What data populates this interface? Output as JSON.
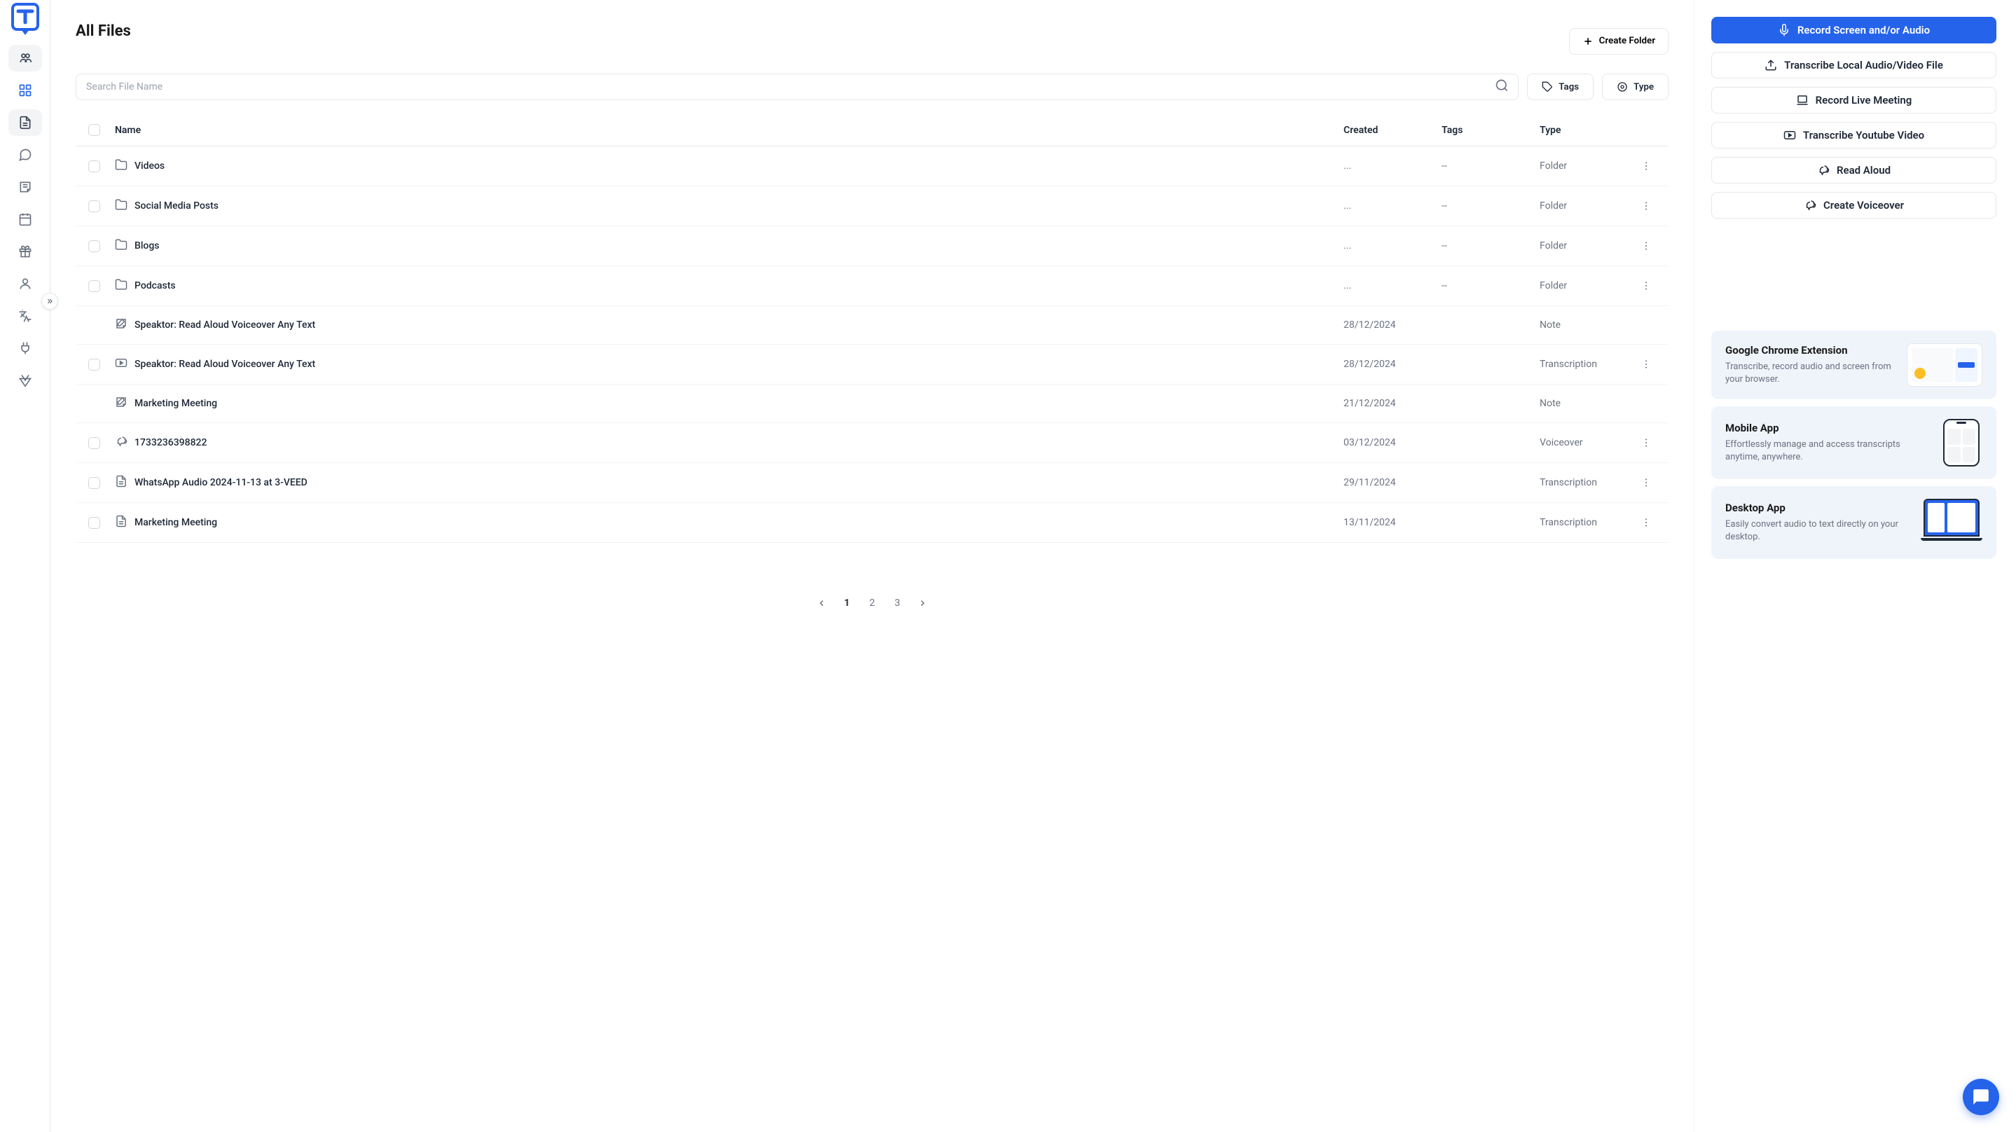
{
  "page": {
    "title": "All Files"
  },
  "search": {
    "placeholder": "Search File Name"
  },
  "toolbar": {
    "create_folder": "Create Folder",
    "tags": "Tags",
    "type": "Type"
  },
  "table": {
    "headers": {
      "name": "Name",
      "created": "Created",
      "tags": "Tags",
      "type": "Type"
    },
    "rows": [
      {
        "icon": "folder",
        "name": "Videos",
        "created": "...",
        "tags": "--",
        "type": "Folder",
        "checkbox": true,
        "actions": true
      },
      {
        "icon": "folder",
        "name": "Social Media Posts",
        "created": "...",
        "tags": "--",
        "type": "Folder",
        "checkbox": true,
        "actions": true
      },
      {
        "icon": "folder",
        "name": "Blogs",
        "created": "...",
        "tags": "--",
        "type": "Folder",
        "checkbox": true,
        "actions": true
      },
      {
        "icon": "folder",
        "name": "Podcasts",
        "created": "...",
        "tags": "--",
        "type": "Folder",
        "checkbox": true,
        "actions": true
      },
      {
        "icon": "note",
        "name": "Speaktor: Read Aloud Voiceover Any Text",
        "created": "28/12/2024",
        "tags": "",
        "type": "Note",
        "checkbox": false,
        "actions": false
      },
      {
        "icon": "youtube",
        "name": "Speaktor: Read Aloud Voiceover Any Text",
        "created": "28/12/2024",
        "tags": "",
        "type": "Transcription",
        "checkbox": true,
        "actions": true
      },
      {
        "icon": "note",
        "name": "Marketing Meeting",
        "created": "21/12/2024",
        "tags": "",
        "type": "Note",
        "checkbox": false,
        "actions": false
      },
      {
        "icon": "voiceover",
        "name": "1733236398822",
        "created": "03/12/2024",
        "tags": "",
        "type": "Voiceover",
        "checkbox": true,
        "actions": true
      },
      {
        "icon": "doc",
        "name": "WhatsApp Audio 2024-11-13 at 3-VEED",
        "created": "29/11/2024",
        "tags": "",
        "type": "Transcription",
        "checkbox": true,
        "actions": true
      },
      {
        "icon": "doc",
        "name": "Marketing Meeting",
        "created": "13/11/2024",
        "tags": "",
        "type": "Transcription",
        "checkbox": true,
        "actions": true
      }
    ]
  },
  "pagination": {
    "pages": [
      "1",
      "2",
      "3"
    ],
    "current": "1"
  },
  "actions": {
    "record_screen": "Record Screen and/or Audio",
    "transcribe_local": "Transcribe Local Audio/Video File",
    "record_meeting": "Record Live Meeting",
    "transcribe_youtube": "Transcribe Youtube Video",
    "read_aloud": "Read Aloud",
    "create_voiceover": "Create Voiceover"
  },
  "promos": [
    {
      "title": "Google Chrome Extension",
      "desc": "Transcribe, record audio and screen from your browser.",
      "img": "browser"
    },
    {
      "title": "Mobile App",
      "desc": "Effortlessly manage and access transcripts anytime, anywhere.",
      "img": "phone"
    },
    {
      "title": "Desktop App",
      "desc": "Easily convert audio to text directly on your desktop.",
      "img": "laptop"
    }
  ]
}
